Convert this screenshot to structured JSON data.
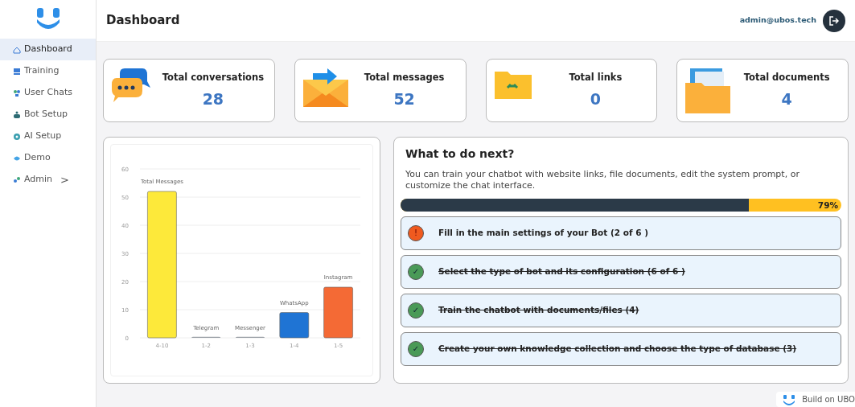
{
  "header": {
    "title": "Dashboard",
    "user": "admin@ubos.tech"
  },
  "sidebar": {
    "items": [
      {
        "label": "Dashboard",
        "selected": true
      },
      {
        "label": "Training",
        "selected": false
      },
      {
        "label": "User Chats",
        "selected": false
      },
      {
        "label": "Bot Setup",
        "selected": false
      },
      {
        "label": "AI Setup",
        "selected": false
      },
      {
        "label": "Demo",
        "selected": false
      },
      {
        "label": "Admin",
        "selected": false,
        "caret": ">"
      }
    ]
  },
  "stats": [
    {
      "label": "Total conversations",
      "value": "28"
    },
    {
      "label": "Total messages",
      "value": "52"
    },
    {
      "label": "Total links",
      "value": "0"
    },
    {
      "label": "Total documents",
      "value": "4"
    }
  ],
  "chart": {
    "chart_data": {
      "type": "bar",
      "categories": [
        "4-10",
        "1-2",
        "1-3",
        "1-4",
        "1-5"
      ],
      "series": [
        {
          "name": "Total Messages",
          "color": "#fde93a",
          "values": [
            52,
            null,
            null,
            null,
            null
          ]
        },
        {
          "name": "Telegram",
          "color": "#9aa0a6",
          "values": [
            null,
            0,
            null,
            null,
            null
          ]
        },
        {
          "name": "Messenger",
          "color": "#9aa0a6",
          "values": [
            null,
            null,
            0,
            null,
            null
          ]
        },
        {
          "name": "WhatsApp",
          "color": "#1f74d4",
          "values": [
            null,
            null,
            null,
            9,
            null
          ]
        },
        {
          "name": "Instagram",
          "color": "#f46a35",
          "values": [
            null,
            null,
            null,
            null,
            18
          ]
        }
      ],
      "ylim": [
        0,
        60
      ],
      "yticks": [
        0,
        10,
        20,
        30,
        40,
        50,
        60
      ],
      "grid": true
    }
  },
  "next": {
    "title": "What to do next?",
    "text": "You can train your chatbot with website links, file documents, edit the system prompt, or customize the chat interface.",
    "level": 0.79,
    "reading": "79%",
    "tasks": [
      {
        "label": "Fill in the main settings of your Bot (2 of 6 )",
        "done": false,
        "mark": "!"
      },
      {
        "label": "Select the type of bot and its configuration (6 of 6 )",
        "done": true,
        "mark": "✓"
      },
      {
        "label": "Train the chatbot with documents/files (4)",
        "done": true,
        "mark": "✓"
      },
      {
        "label": "Create your own knowledge collection and choose the type of database  (3)",
        "done": true,
        "mark": "✓"
      }
    ]
  },
  "footer": {
    "text": "Build on UBO"
  }
}
